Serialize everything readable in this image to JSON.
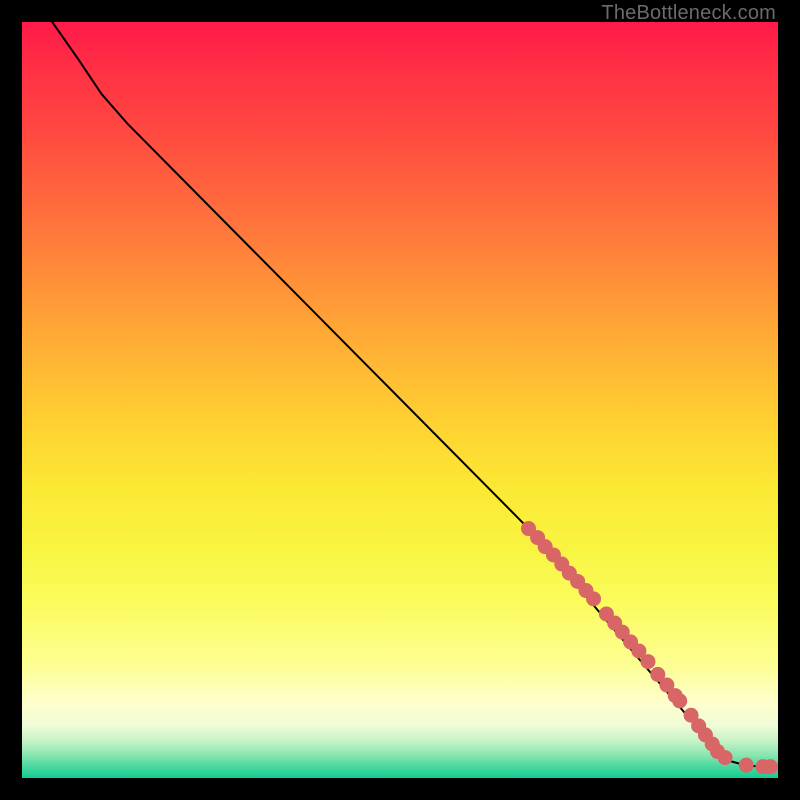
{
  "watermark": "TheBottleneck.com",
  "colors": {
    "background": "#000000",
    "marker": "#d86666",
    "curve": "#000000"
  },
  "chart_data": {
    "type": "line",
    "title": "",
    "xlabel": "",
    "ylabel": "",
    "xlim": [
      0,
      100
    ],
    "ylim": [
      0,
      100
    ],
    "grid": false,
    "curve_points": [
      {
        "x": 4.0,
        "y": 100.0
      },
      {
        "x": 7.5,
        "y": 95.0
      },
      {
        "x": 10.5,
        "y": 90.5
      },
      {
        "x": 14.0,
        "y": 86.5
      },
      {
        "x": 67.0,
        "y": 33.0
      },
      {
        "x": 92.0,
        "y": 3.5
      },
      {
        "x": 93.8,
        "y": 2.2
      },
      {
        "x": 96.0,
        "y": 1.6
      },
      {
        "x": 99.0,
        "y": 1.5
      }
    ],
    "series": [
      {
        "name": "highlighted-points",
        "type": "scatter",
        "points": [
          {
            "x": 67.0,
            "y": 33.0
          },
          {
            "x": 68.2,
            "y": 31.8
          },
          {
            "x": 69.2,
            "y": 30.6
          },
          {
            "x": 70.3,
            "y": 29.5
          },
          {
            "x": 71.4,
            "y": 28.3
          },
          {
            "x": 72.4,
            "y": 27.1
          },
          {
            "x": 73.5,
            "y": 26.0
          },
          {
            "x": 74.6,
            "y": 24.8
          },
          {
            "x": 75.6,
            "y": 23.7
          },
          {
            "x": 77.3,
            "y": 21.7
          },
          {
            "x": 78.4,
            "y": 20.5
          },
          {
            "x": 79.4,
            "y": 19.3
          },
          {
            "x": 80.5,
            "y": 18.0
          },
          {
            "x": 81.6,
            "y": 16.8
          },
          {
            "x": 82.8,
            "y": 15.4
          },
          {
            "x": 84.1,
            "y": 13.7
          },
          {
            "x": 85.3,
            "y": 12.3
          },
          {
            "x": 86.4,
            "y": 10.9
          },
          {
            "x": 87.0,
            "y": 10.2
          },
          {
            "x": 88.5,
            "y": 8.3
          },
          {
            "x": 89.5,
            "y": 6.9
          },
          {
            "x": 90.4,
            "y": 5.7
          },
          {
            "x": 91.3,
            "y": 4.5
          },
          {
            "x": 92.0,
            "y": 3.5
          },
          {
            "x": 93.0,
            "y": 2.7
          },
          {
            "x": 95.8,
            "y": 1.7
          },
          {
            "x": 98.0,
            "y": 1.5
          },
          {
            "x": 99.0,
            "y": 1.5
          }
        ]
      }
    ]
  }
}
